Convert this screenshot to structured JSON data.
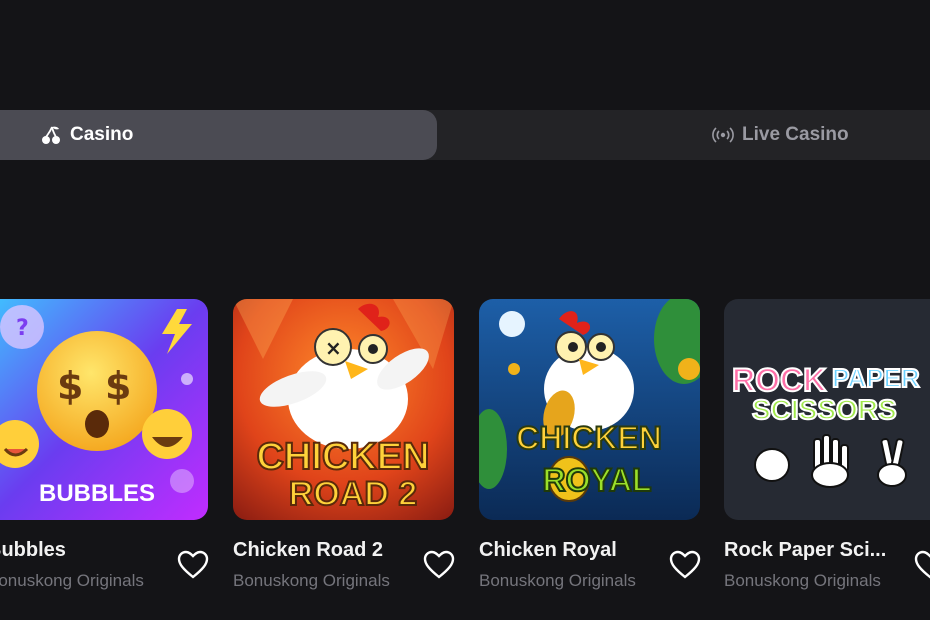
{
  "tabs": [
    {
      "label": "Casino",
      "icon": "cherries-icon",
      "active": true
    },
    {
      "label": "Live Casino",
      "icon": "broadcast-icon",
      "active": false
    }
  ],
  "games": [
    {
      "title": "Bubbles",
      "provider": "Bonuskong Originals",
      "art_text": "BUBBLES"
    },
    {
      "title": "Chicken Road 2",
      "provider": "Bonuskong Originals",
      "art_text_1": "CHICKEN",
      "art_text_2": "ROAD 2"
    },
    {
      "title": "Chicken Royal",
      "provider": "Bonuskong Originals",
      "art_text_1": "CHICKEN",
      "art_text_2": "ROYAL"
    },
    {
      "title": "Rock Paper Sci...",
      "provider": "Bonuskong Originals",
      "art_text_1": "ROCK",
      "art_text_2": "PAPER",
      "art_text_3": "SCISSORS"
    }
  ],
  "colors": {
    "background": "#141417",
    "tab_bar": "#232326",
    "tab_active": "#4b4b53",
    "muted_text": "#75757c"
  }
}
